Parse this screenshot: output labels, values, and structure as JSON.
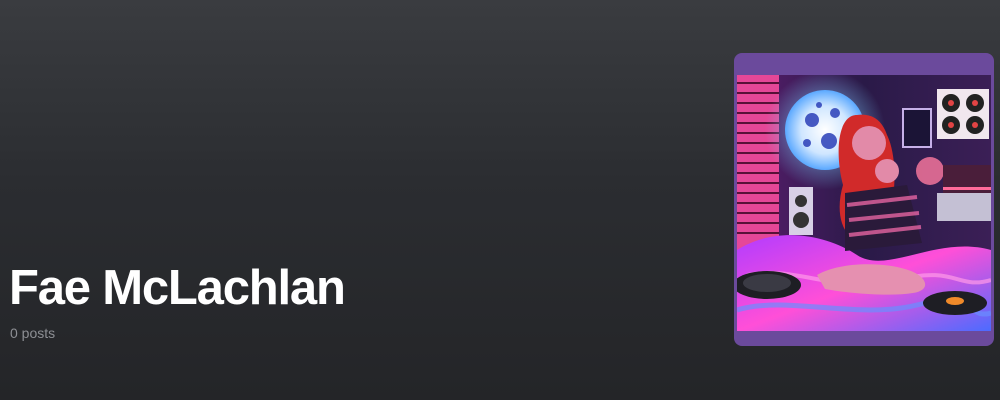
{
  "profile": {
    "name": "Fae McLachlan",
    "posts_label": "0 posts"
  },
  "avatar": {
    "description_icon": "profile-picture",
    "frame_color": "#6b4a9c"
  },
  "colors": {
    "background_top": "#3a3c40",
    "background_bottom": "#242528",
    "name_text": "#ffffff",
    "meta_text": "#8d8f94"
  }
}
